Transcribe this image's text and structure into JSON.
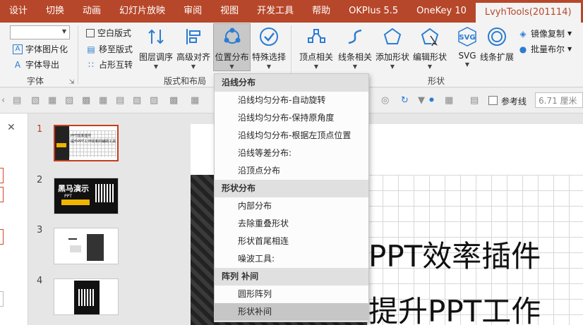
{
  "tabs": [
    {
      "label": "设计"
    },
    {
      "label": "切换"
    },
    {
      "label": "动画"
    },
    {
      "label": "幻灯片放映"
    },
    {
      "label": "审阅"
    },
    {
      "label": "视图"
    },
    {
      "label": "开发工具"
    },
    {
      "label": "帮助"
    },
    {
      "label": "OKPlus 5.5"
    },
    {
      "label": "OneKey 10"
    },
    {
      "label": "LvyhTools(201114)"
    }
  ],
  "ribbon": {
    "font_group": {
      "font_image": "字体图片化",
      "font_export": "字体导出",
      "label": "字体"
    },
    "layout_group": {
      "blank_layout": "空白版式",
      "move_to_layout": "移至版式",
      "placeholder_swap": "占形互转",
      "layer_order": "图层调序",
      "advanced_align": "高级对齐",
      "position_distribute": "位置分布",
      "special_select": "特殊选择",
      "label": "版式和布局"
    },
    "shape_group": {
      "vertex": "顶点相关",
      "line": "线条相关",
      "add_shape": "添加形状",
      "edit_shape": "编辑形状",
      "svg": "SVG",
      "line_ext": "线条扩展",
      "mirror_copy": "镜像复制",
      "batch_bool": "批量布尔",
      "svg_icon_text": "SVG",
      "label": "形状"
    }
  },
  "toolbar2": {
    "ref_line": "参考线",
    "unit_value": "6.71 厘米"
  },
  "slides": [
    {
      "num": "1"
    },
    {
      "num": "2"
    },
    {
      "num": "3"
    },
    {
      "num": "4"
    }
  ],
  "thumb2": {
    "title": "黑马演示",
    "sub": "PPT"
  },
  "thumb1": {
    "line1": "PPT效率插件",
    "line2": "提升PPT工作效率的辅助工具"
  },
  "slide": {
    "line1": "PPT效率插件",
    "line2": "提升PPT工作"
  },
  "menu": {
    "sections": [
      {
        "header": "沿线分布",
        "items": [
          "沿线均匀分布-自动旋转",
          "沿线均匀分布-保持原角度",
          "沿线均匀分布-根据左顶点位置",
          "沿线等差分布:",
          "沿顶点分布"
        ]
      },
      {
        "header": "形状分布",
        "items": [
          "内部分布",
          "去除重叠形状",
          "形状首尾相连",
          "噪波工具:"
        ]
      },
      {
        "header": "阵列 补间",
        "items": [
          "圆形阵列",
          "形状补间"
        ]
      }
    ]
  },
  "colors": {
    "accent": "#b7472a",
    "active_slide": "#c43e1c"
  }
}
